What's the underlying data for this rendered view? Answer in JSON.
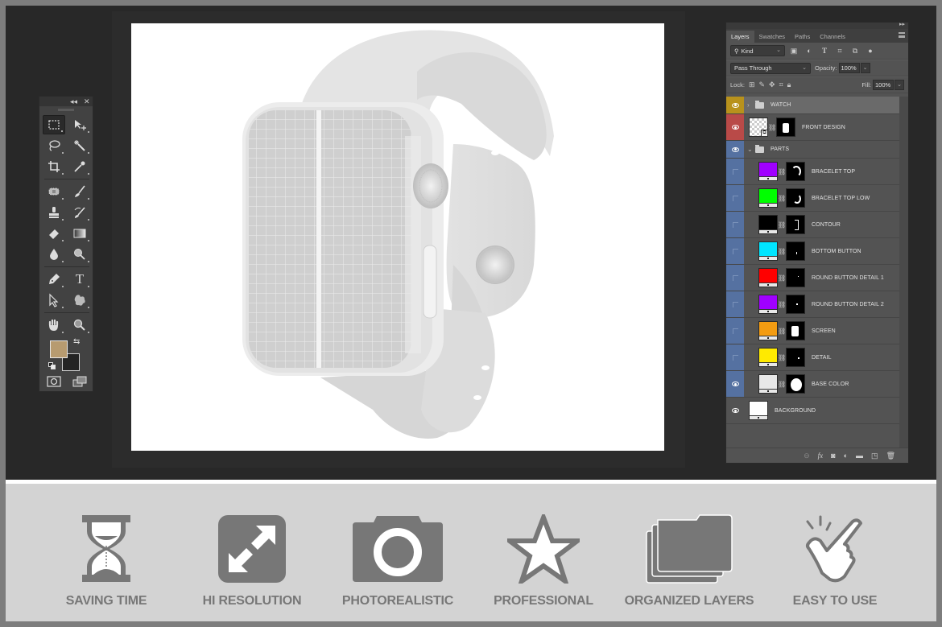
{
  "tools_panel": {
    "collapse_label": "◂◂",
    "close_label": "✕",
    "tools": [
      {
        "name": "rectangular-marquee-tool",
        "active": true
      },
      {
        "name": "move-tool"
      },
      {
        "name": "lasso-tool"
      },
      {
        "name": "magic-wand-tool"
      },
      {
        "name": "crop-tool"
      },
      {
        "name": "eyedropper-tool"
      },
      {
        "name": "spot-healing-brush-tool"
      },
      {
        "name": "brush-tool"
      },
      {
        "name": "clone-stamp-tool"
      },
      {
        "name": "history-brush-tool"
      },
      {
        "name": "eraser-tool"
      },
      {
        "name": "gradient-tool"
      },
      {
        "name": "blur-tool"
      },
      {
        "name": "dodge-tool"
      },
      {
        "name": "pen-tool"
      },
      {
        "name": "type-tool"
      },
      {
        "name": "path-selection-tool"
      },
      {
        "name": "custom-shape-tool"
      },
      {
        "name": "hand-tool"
      },
      {
        "name": "zoom-tool"
      }
    ],
    "type_tool_glyph": "T",
    "foreground_color": "#b79b70",
    "background_color": "#242424",
    "swap_glyph": "⇆"
  },
  "layers_panel": {
    "tabs": [
      "Layers",
      "Swatches",
      "Paths",
      "Channels"
    ],
    "active_tab": "Layers",
    "filter": {
      "value": "Kind",
      "search_glyph": "⚲"
    },
    "blend_mode": "Pass Through",
    "opacity_label": "Opacity:",
    "opacity_value": "100%",
    "lock_label": "Lock:",
    "fill_label": "Fill:",
    "fill_value": "100%",
    "layers": [
      {
        "name": "WATCH",
        "type": "group",
        "collapsed": true,
        "visible": true,
        "tag_color": "#b8921c",
        "selected": true
      },
      {
        "name": "FRONT DESIGN",
        "type": "smart-object",
        "visible": true,
        "tag_color": "#b94a48"
      },
      {
        "name": "PARTS",
        "type": "group",
        "collapsed": false,
        "visible": true,
        "tag_color": "#5571a1"
      },
      {
        "name": "BRACELET TOP",
        "type": "fill",
        "visible": false,
        "fill_color": "#a000ff",
        "tag_color": "#5571a1"
      },
      {
        "name": "BRACELET TOP LOW",
        "type": "fill",
        "visible": false,
        "fill_color": "#00ff00",
        "tag_color": "#5571a1"
      },
      {
        "name": "CONTOUR",
        "type": "fill",
        "visible": false,
        "fill_color": "#000000",
        "tag_color": "#5571a1"
      },
      {
        "name": "BOTTOM BUTTON",
        "type": "fill",
        "visible": false,
        "fill_color": "#00e5ff",
        "tag_color": "#5571a1"
      },
      {
        "name": "ROUND BUTTON DETAIL 1",
        "type": "fill",
        "visible": false,
        "fill_color": "#ff0000",
        "tag_color": "#5571a1"
      },
      {
        "name": "ROUND BUTTON DETAIL 2",
        "type": "fill",
        "visible": false,
        "fill_color": "#a000ff",
        "tag_color": "#5571a1"
      },
      {
        "name": "SCREEN",
        "type": "fill",
        "visible": false,
        "fill_color": "#f39c12",
        "tag_color": "#5571a1"
      },
      {
        "name": "DETAIL",
        "type": "fill",
        "visible": false,
        "fill_color": "#ffea00",
        "tag_color": "#5571a1"
      },
      {
        "name": "BASE COLOR",
        "type": "fill",
        "visible": true,
        "fill_color": "#e8e8e8",
        "tag_color": "#5571a1"
      },
      {
        "name": "BACKGROUND",
        "type": "background",
        "visible": true,
        "fill_color": "#ffffff"
      }
    ],
    "footer_icons": [
      "link-layers",
      "fx",
      "add-mask",
      "adjustment-layer",
      "new-group",
      "new-layer",
      "delete-layer"
    ],
    "fx_label": "fx"
  },
  "canvas": {
    "subject": "smartwatch mockup with grid screen"
  },
  "features": [
    {
      "label": "SAVING TIME",
      "icon": "hourglass-icon"
    },
    {
      "label": "HI RESOLUTION",
      "icon": "expand-arrows-icon"
    },
    {
      "label": "PHOTOREALISTIC",
      "icon": "camera-icon"
    },
    {
      "label": "PROFESSIONAL",
      "icon": "star-icon"
    },
    {
      "label": "ORGANIZED LAYERS",
      "icon": "stacked-folders-icon"
    },
    {
      "label": "EASY TO USE",
      "icon": "tap-hand-icon"
    }
  ]
}
